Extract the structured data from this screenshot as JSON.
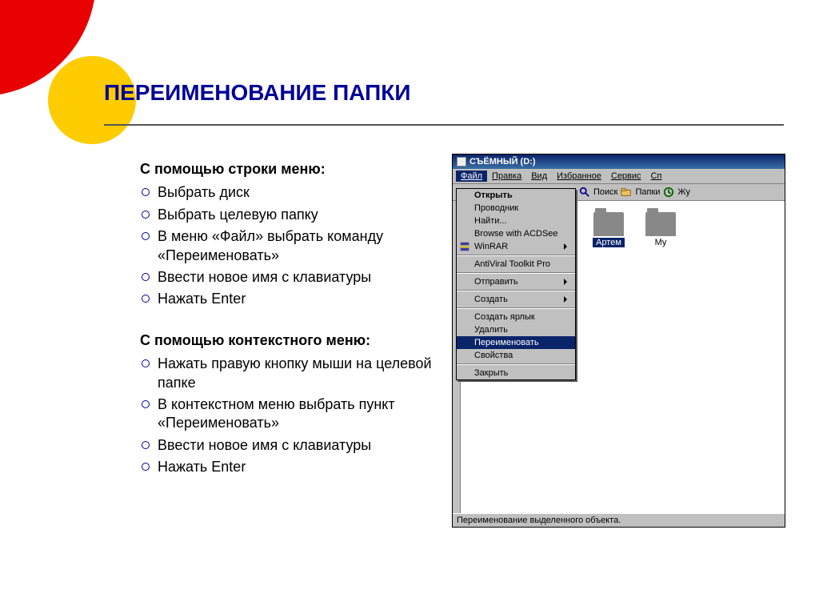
{
  "title": "ПЕРЕИМЕНОВАНИЕ ПАПКИ",
  "section1_heading": "С помощью строки меню:",
  "section1_items": [
    "Выбрать диск",
    "Выбрать целевую папку",
    "В меню «Файл» выбрать команду «Переименовать»",
    "Ввести новое имя с клавиатуры",
    "Нажать Enter"
  ],
  "section2_heading": "С помощью контекстного меню:",
  "section2_items": [
    "Нажать правую кнопку мыши на целевой папке",
    "В контекстном меню выбрать пункт «Переименовать»",
    "Ввести новое имя с клавиатуры",
    "Нажать Enter"
  ],
  "window_title": "СЪЁМНЫЙ (D:)",
  "menubar": {
    "file": "Файл",
    "edit": "Правка",
    "view": "Вид",
    "fav": "Избранное",
    "tools": "Сервис",
    "help": "Сп"
  },
  "toolbar": {
    "search": "Поиск",
    "folders": "Папки",
    "log": "Жу"
  },
  "dropdown": {
    "open": "Открыть",
    "explorer": "Проводник",
    "find": "Найти...",
    "acdsee": "Browse with ACDSee",
    "winrar": "WinRAR",
    "avp": "AntiViral Toolkit Pro",
    "send": "Отправить",
    "create": "Создать",
    "shortcut": "Создать ярлык",
    "delete": "Удалить",
    "rename": "Переименовать",
    "properties": "Свойства",
    "close": "Закрыть"
  },
  "folder_selected": "Артем",
  "folder_other": "Му",
  "statusbar": "Переименование выделенного объекта."
}
